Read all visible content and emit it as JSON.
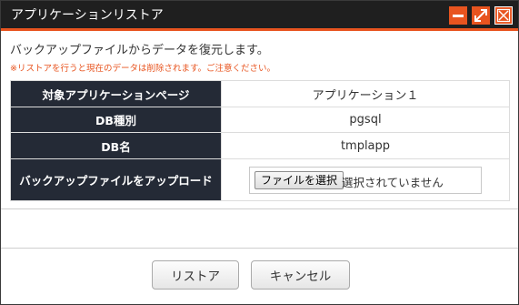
{
  "dialog": {
    "title": "アプリケーションリストア",
    "controls": {
      "minimize": "minimize-icon",
      "maximize": "maximize-icon",
      "close": "close-icon"
    },
    "accent_color": "#e8541f"
  },
  "message": {
    "intro": "バックアップファイルからデータを復元します。",
    "warning": "※リストアを行うと現在のデータは削除されます。ご注意ください。"
  },
  "table": {
    "rows": [
      {
        "label": "対象アプリケーションページ",
        "value": "アプリケーション１"
      },
      {
        "label": "DB種別",
        "value": "pgsql"
      },
      {
        "label": "DB名",
        "value": "tmplapp"
      },
      {
        "label": "バックアップファイルをアップロード"
      }
    ],
    "file_input": {
      "button_label": "ファイルを選択",
      "status": "選択されていません"
    }
  },
  "actions": {
    "restore_label": "リストア",
    "cancel_label": "キャンセル"
  }
}
